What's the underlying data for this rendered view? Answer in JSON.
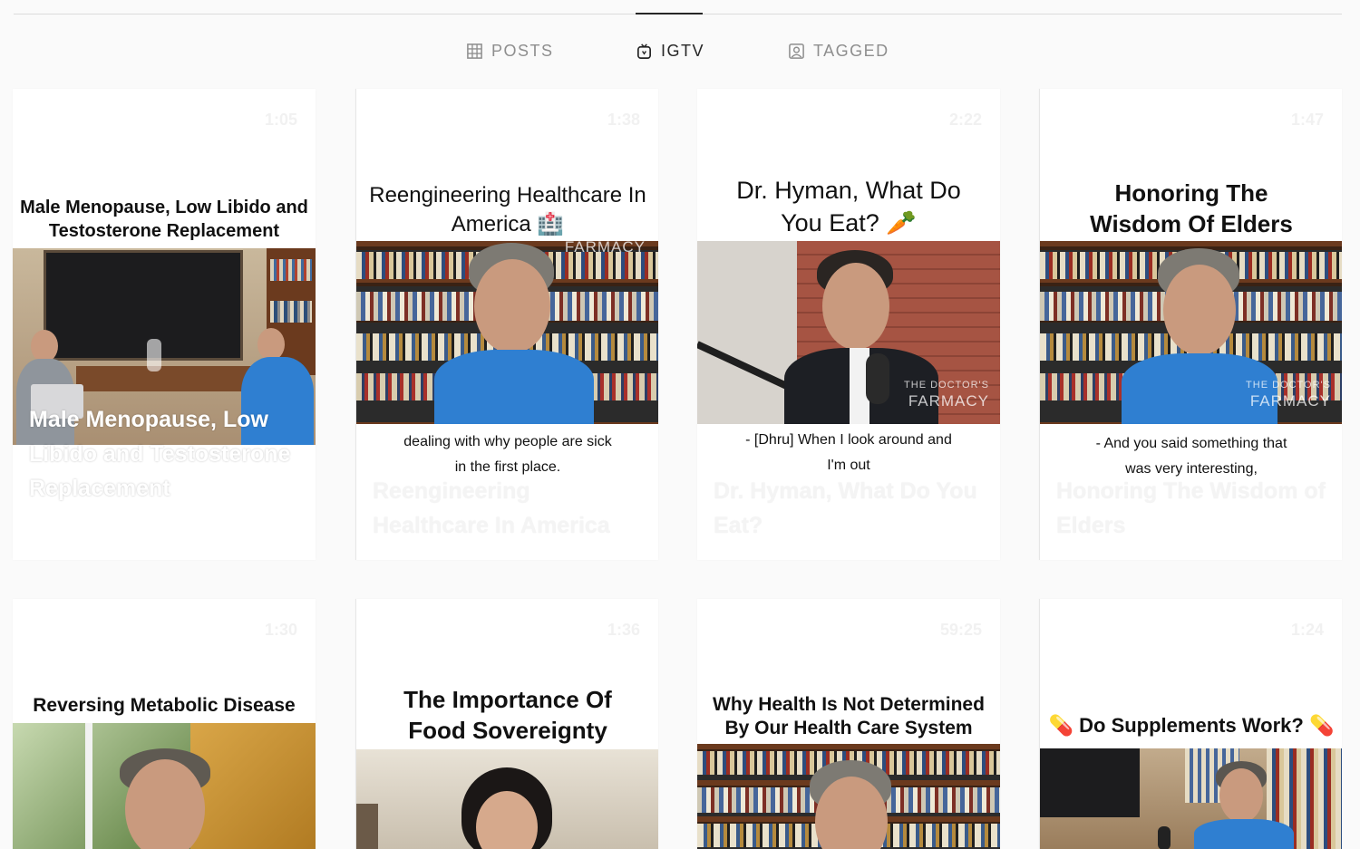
{
  "tabs": {
    "posts": "POSTS",
    "igtv": "IGTV",
    "tagged": "TAGGED"
  },
  "cards": [
    {
      "duration": "1:05",
      "title": "Male Menopause, Low Libido and Testosterone Replacement",
      "caption": "",
      "overlay": "Male Menopause, Low Libido and Testosterone Replacement"
    },
    {
      "duration": "1:38",
      "title": "Reengineering Healthcare In America 🏥",
      "caption": "dealing with why people are sick in the first place.",
      "overlay": "Reengineering Healthcare In America"
    },
    {
      "duration": "2:22",
      "title": "Dr. Hyman, What Do You Eat? 🥕",
      "caption": "- [Dhru] When I look around and I'm out",
      "overlay": "Dr. Hyman, What Do You Eat?"
    },
    {
      "duration": "1:47",
      "title": "Honoring The Wisdom Of Elders",
      "caption": "- And you said something that was very interesting,",
      "overlay": "Honoring The Wisdom of Elders"
    },
    {
      "duration": "1:30",
      "title": "Reversing Metabolic Disease",
      "caption": "",
      "overlay": ""
    },
    {
      "duration": "1:36",
      "title": "The Importance Of Food Sovereignty",
      "caption": "",
      "overlay": ""
    },
    {
      "duration": "59:25",
      "title": "Why Health Is Not Determined By Our Health Care System",
      "caption": "",
      "overlay": ""
    },
    {
      "duration": "1:24",
      "title": "💊 Do Supplements Work? 💊",
      "caption": "",
      "overlay": ""
    }
  ],
  "watermark": {
    "line1": "THE DOCTOR'S",
    "line2": "FARMACY"
  },
  "colors": {
    "tab_active": "#262626",
    "tab_inactive": "#8e8e8e",
    "shirt_blue": "#2f7fd1",
    "shelf_wood": "#6b3a1e"
  }
}
